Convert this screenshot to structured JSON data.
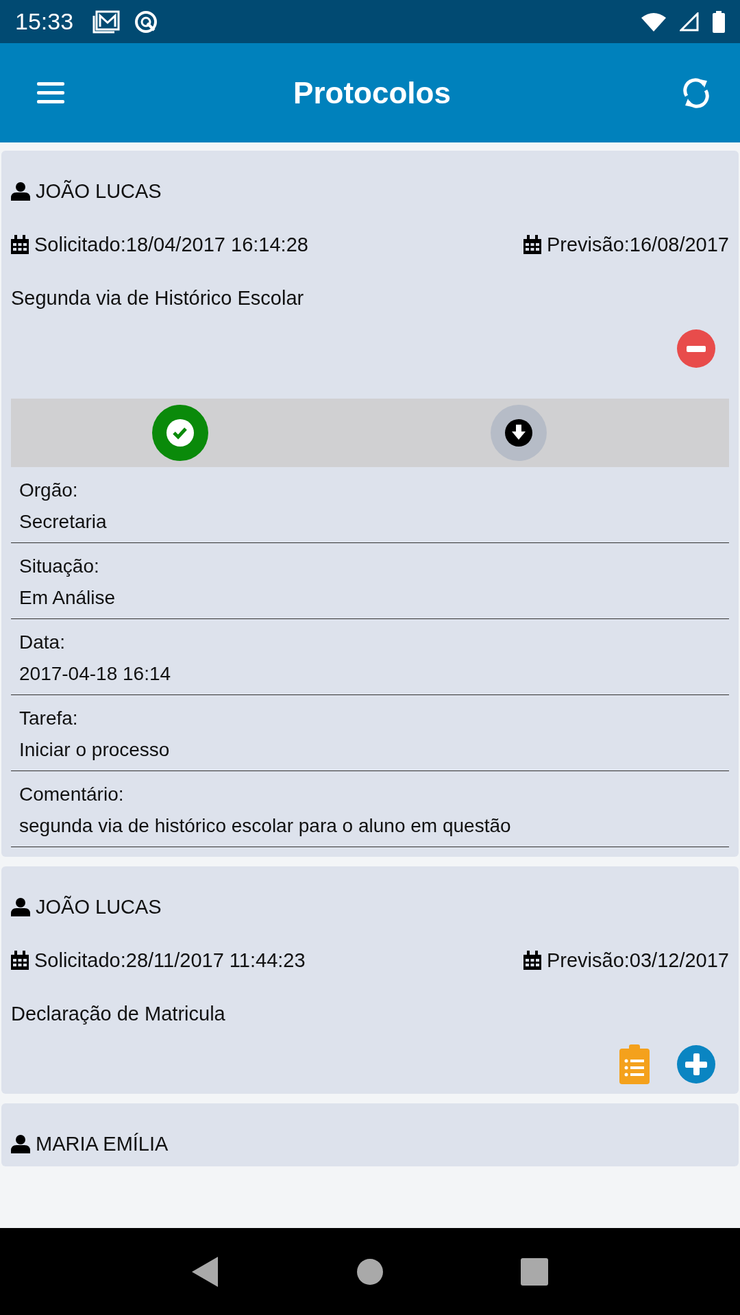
{
  "status_bar": {
    "time": "15:33"
  },
  "app_bar": {
    "title": "Protocolos"
  },
  "protocols": [
    {
      "name": "JOÃO LUCAS",
      "requested": "Solicitado:18/04/2017 16:14:28",
      "forecast": "Previsão:16/08/2017",
      "description": "Segunda via de Histórico Escolar",
      "expanded": true,
      "details": [
        {
          "label": "Orgão:",
          "value": "Secretaria"
        },
        {
          "label": "Situação:",
          "value": "Em Análise"
        },
        {
          "label": "Data:",
          "value": "2017-04-18 16:14"
        },
        {
          "label": "Tarefa:",
          "value": "Iniciar o processo"
        },
        {
          "label": "Comentário:",
          "value": "segunda via de histórico escolar para o aluno em questão"
        }
      ]
    },
    {
      "name": "JOÃO LUCAS",
      "requested": "Solicitado:28/11/2017 11:44:23",
      "forecast": "Previsão:03/12/2017",
      "description": "Declaração de Matricula",
      "expanded": false
    },
    {
      "name": "MARIA EMÍLIA"
    }
  ]
}
